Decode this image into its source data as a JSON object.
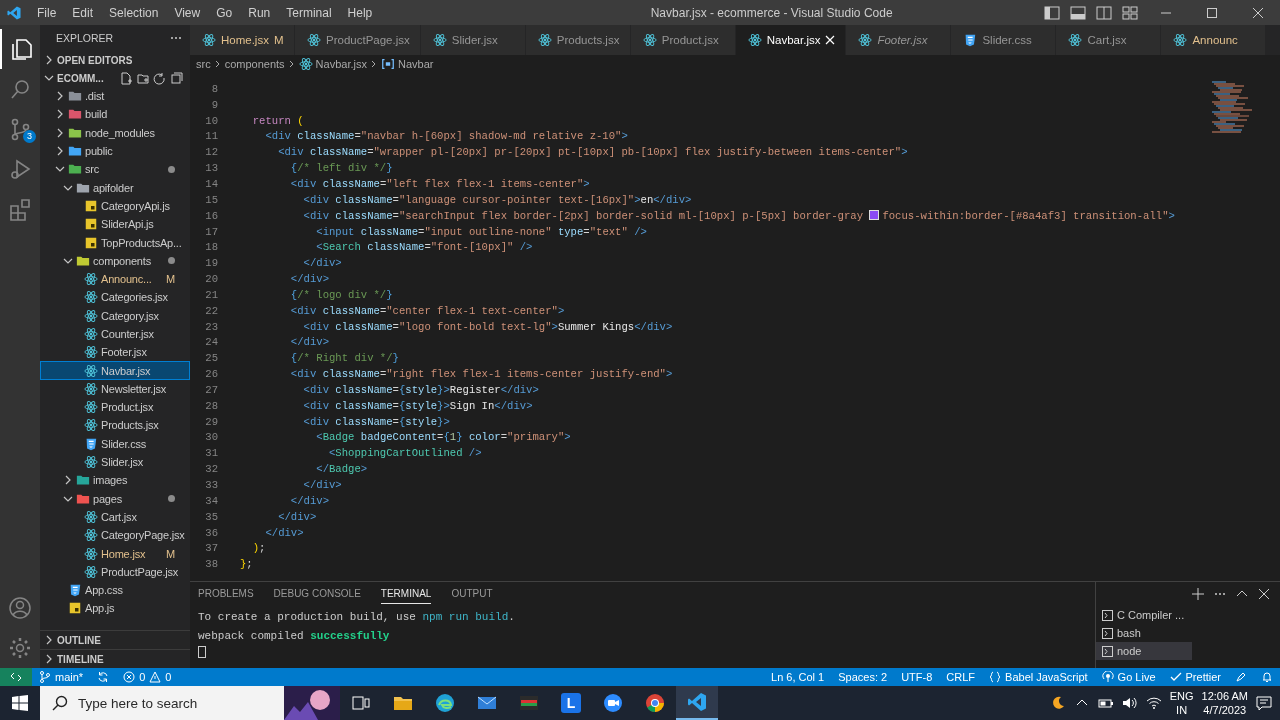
{
  "window": {
    "title": "Navbar.jsx - ecommerce - Visual Studio Code"
  },
  "menu": [
    "File",
    "Edit",
    "Selection",
    "View",
    "Go",
    "Run",
    "Terminal",
    "Help"
  ],
  "activity_bar": [
    {
      "kind": "files",
      "selected": true
    },
    {
      "kind": "search",
      "selected": false
    },
    {
      "kind": "source-control",
      "selected": false,
      "badge": "3"
    },
    {
      "kind": "run",
      "selected": false
    },
    {
      "kind": "extensions",
      "selected": false
    }
  ],
  "sidebar": {
    "title": "EXPLORER",
    "sections": [
      "OPEN EDITORS"
    ],
    "project": "ECOMM...",
    "bottom_sections": [
      "OUTLINE",
      "TIMELINE"
    ],
    "tree": [
      {
        "name": ".dist",
        "kind": "folder",
        "color": "#8a8f98",
        "expanded": false,
        "dot": false,
        "selected": false
      },
      {
        "name": "build",
        "kind": "folder",
        "color": "#d9556b",
        "expanded": false,
        "dot": false,
        "selected": false
      },
      {
        "name": "node_modules",
        "kind": "folder",
        "color": "#8bc34a",
        "expanded": false,
        "dot": false,
        "selected": false
      },
      {
        "name": "public",
        "kind": "folder",
        "color": "#42a5f5",
        "expanded": false,
        "dot": false,
        "selected": false
      },
      {
        "name": "src",
        "kind": "folder",
        "color": "#4caf50",
        "expanded": true,
        "dot": true,
        "selected": false,
        "children": [
          {
            "name": "apifolder",
            "kind": "folder",
            "color": "#9ea4ad",
            "expanded": true,
            "dot": false,
            "selected": false,
            "children": [
              {
                "name": "CategoryApi.js",
                "kind": "js",
                "selected": false
              },
              {
                "name": "SliderApi.js",
                "kind": "js",
                "selected": false
              },
              {
                "name": "TopProductsAp...",
                "kind": "js",
                "selected": false
              }
            ]
          },
          {
            "name": "components",
            "kind": "folder",
            "color": "#c0ca33",
            "expanded": true,
            "dot": true,
            "selected": false,
            "children": [
              {
                "name": "Announc...",
                "kind": "jsx",
                "selected": false,
                "badge": "M"
              },
              {
                "name": "Categories.jsx",
                "kind": "jsx",
                "selected": false
              },
              {
                "name": "Category.jsx",
                "kind": "jsx",
                "selected": false
              },
              {
                "name": "Counter.jsx",
                "kind": "jsx",
                "selected": false
              },
              {
                "name": "Footer.jsx",
                "kind": "jsx",
                "selected": false
              },
              {
                "name": "Navbar.jsx",
                "kind": "jsx",
                "selected": true
              },
              {
                "name": "Newsletter.jsx",
                "kind": "jsx",
                "selected": false
              },
              {
                "name": "Product.jsx",
                "kind": "jsx",
                "selected": false
              },
              {
                "name": "Products.jsx",
                "kind": "jsx",
                "selected": false
              },
              {
                "name": "Slider.css",
                "kind": "css",
                "selected": false
              },
              {
                "name": "Slider.jsx",
                "kind": "jsx",
                "selected": false
              }
            ]
          },
          {
            "name": "images",
            "kind": "folder",
            "color": "#26a69a",
            "expanded": false,
            "dot": false,
            "selected": false
          },
          {
            "name": "pages",
            "kind": "folder",
            "color": "#ef5350",
            "expanded": true,
            "dot": true,
            "selected": false,
            "children": [
              {
                "name": "Cart.jsx",
                "kind": "jsx",
                "selected": false
              },
              {
                "name": "CategoryPage.jsx",
                "kind": "jsx",
                "selected": false
              },
              {
                "name": "Home.jsx",
                "kind": "jsx",
                "selected": false,
                "badge": "M"
              },
              {
                "name": "ProductPage.jsx",
                "kind": "jsx",
                "selected": false
              }
            ]
          }
        ]
      },
      {
        "name": "App.css",
        "kind": "css",
        "selected": false
      },
      {
        "name": "App.js",
        "kind": "js",
        "selected": false
      }
    ]
  },
  "tabs": [
    {
      "label": "Home.jsx",
      "kind": "jsx",
      "selected": false,
      "italic": false,
      "badge": "M"
    },
    {
      "label": "ProductPage.jsx",
      "kind": "jsx",
      "selected": false,
      "italic": false
    },
    {
      "label": "Slider.jsx",
      "kind": "jsx",
      "selected": false,
      "italic": false
    },
    {
      "label": "Products.jsx",
      "kind": "jsx",
      "selected": false,
      "italic": false
    },
    {
      "label": "Product.jsx",
      "kind": "jsx",
      "selected": false,
      "italic": false
    },
    {
      "label": "Navbar.jsx",
      "kind": "jsx",
      "selected": true,
      "italic": false
    },
    {
      "label": "Footer.jsx",
      "kind": "jsx",
      "selected": false,
      "italic": true
    },
    {
      "label": "Slider.css",
      "kind": "css",
      "selected": false,
      "italic": false
    },
    {
      "label": "Cart.jsx",
      "kind": "jsx",
      "selected": false,
      "italic": false
    },
    {
      "label": "Announc",
      "kind": "jsx",
      "selected": false,
      "italic": false,
      "modified": true
    }
  ],
  "breadcrumb": [
    {
      "label": "src",
      "kind": "folder"
    },
    {
      "label": "components",
      "kind": "folder"
    },
    {
      "label": "Navbar.jsx",
      "kind": "jsx"
    },
    {
      "label": "Navbar",
      "kind": "symbol"
    }
  ],
  "code": [
    {
      "number": "8"
    },
    {
      "number": "9"
    },
    {
      "number": "10",
      "tokens": [
        {
          "kind": "kw",
          "text": "  return"
        },
        {
          "kind": "paren",
          "text": " ("
        }
      ]
    },
    {
      "number": "11",
      "tokens": [
        {
          "kind": "tag",
          "text": "    <div"
        },
        {
          "kind": "attr",
          "text": " className"
        },
        {
          "kind": "op",
          "text": "="
        },
        {
          "kind": "str",
          "text": "\"navbar h-[60px] shadow-md relative z-10\""
        },
        {
          "kind": "tag",
          "text": ">"
        }
      ]
    },
    {
      "number": "12",
      "tokens": [
        {
          "kind": "tag",
          "text": "      <div"
        },
        {
          "kind": "attr",
          "text": " className"
        },
        {
          "kind": "op",
          "text": "="
        },
        {
          "kind": "str",
          "text": "\"wrapper pl-[20px] pr-[20px] pt-[10px] pb-[10px] flex justify-between items-center\""
        },
        {
          "kind": "tag",
          "text": ">"
        }
      ]
    },
    {
      "number": "13",
      "tokens": [
        {
          "kind": "brace",
          "text": "        {"
        },
        {
          "kind": "comment",
          "text": "/* left div */"
        },
        {
          "kind": "brace",
          "text": "}"
        }
      ]
    },
    {
      "number": "14",
      "tokens": [
        {
          "kind": "tag",
          "text": "        <div"
        },
        {
          "kind": "attr",
          "text": " className"
        },
        {
          "kind": "op",
          "text": "="
        },
        {
          "kind": "str",
          "text": "\"left flex flex-1 items-center\""
        },
        {
          "kind": "tag",
          "text": ">"
        }
      ]
    },
    {
      "number": "15",
      "tokens": [
        {
          "kind": "tag",
          "text": "          <div"
        },
        {
          "kind": "attr",
          "text": " className"
        },
        {
          "kind": "op",
          "text": "="
        },
        {
          "kind": "str",
          "text": "\"language cursor-pointer text-[16px]\""
        },
        {
          "kind": "tag",
          "text": ">"
        },
        {
          "kind": "text",
          "text": "en"
        },
        {
          "kind": "tag",
          "text": "</div>"
        }
      ]
    },
    {
      "number": "16",
      "tokens": [
        {
          "kind": "tag",
          "text": "          <div"
        },
        {
          "kind": "attr",
          "text": " className"
        },
        {
          "kind": "op",
          "text": "="
        },
        {
          "kind": "str",
          "text": "\"searchInput flex border-[2px] border-solid ml-[10px] p-[5px] border-gray "
        },
        {
          "kind": "swatch",
          "color": "#8a4af3"
        },
        {
          "kind": "str",
          "text": "focus-within:border-[#8a4af3] transition-all\""
        },
        {
          "kind": "tag",
          "text": ">"
        }
      ]
    },
    {
      "number": "17",
      "tokens": [
        {
          "kind": "tag",
          "text": "            <input"
        },
        {
          "kind": "attr",
          "text": " className"
        },
        {
          "kind": "op",
          "text": "="
        },
        {
          "kind": "str",
          "text": "\"input outline-none\""
        },
        {
          "kind": "attr",
          "text": " type"
        },
        {
          "kind": "op",
          "text": "="
        },
        {
          "kind": "str",
          "text": "\"text\""
        },
        {
          "kind": "tag",
          "text": " />"
        }
      ]
    },
    {
      "number": "18",
      "tokens": [
        {
          "kind": "tag",
          "text": "            <"
        },
        {
          "kind": "comp",
          "text": "Search"
        },
        {
          "kind": "attr",
          "text": " className"
        },
        {
          "kind": "op",
          "text": "="
        },
        {
          "kind": "str",
          "text": "\"font-[10px]\""
        },
        {
          "kind": "tag",
          "text": " />"
        }
      ]
    },
    {
      "number": "19",
      "tokens": [
        {
          "kind": "tag",
          "text": "          </div>"
        }
      ]
    },
    {
      "number": "20",
      "tokens": [
        {
          "kind": "tag",
          "text": "        </div>"
        }
      ]
    },
    {
      "number": "21",
      "tokens": [
        {
          "kind": "brace",
          "text": "        {"
        },
        {
          "kind": "comment",
          "text": "/* logo div */"
        },
        {
          "kind": "brace",
          "text": "}"
        }
      ]
    },
    {
      "number": "22",
      "tokens": [
        {
          "kind": "tag",
          "text": "        <div"
        },
        {
          "kind": "attr",
          "text": " className"
        },
        {
          "kind": "op",
          "text": "="
        },
        {
          "kind": "str",
          "text": "\"center flex-1 text-center\""
        },
        {
          "kind": "tag",
          "text": ">"
        }
      ]
    },
    {
      "number": "23",
      "tokens": [
        {
          "kind": "tag",
          "text": "          <div"
        },
        {
          "kind": "attr",
          "text": " className"
        },
        {
          "kind": "op",
          "text": "="
        },
        {
          "kind": "str",
          "text": "\"logo font-bold text-lg\""
        },
        {
          "kind": "tag",
          "text": ">"
        },
        {
          "kind": "text",
          "text": "Summer Kings"
        },
        {
          "kind": "tag",
          "text": "</div>"
        }
      ]
    },
    {
      "number": "24",
      "tokens": [
        {
          "kind": "tag",
          "text": "        </div>"
        }
      ]
    },
    {
      "number": "25",
      "tokens": [
        {
          "kind": "brace",
          "text": "        {"
        },
        {
          "kind": "comment",
          "text": "/* Right div */"
        },
        {
          "kind": "brace",
          "text": "}"
        }
      ]
    },
    {
      "number": "26",
      "tokens": [
        {
          "kind": "tag",
          "text": "        <div"
        },
        {
          "kind": "attr",
          "text": " className"
        },
        {
          "kind": "op",
          "text": "="
        },
        {
          "kind": "str",
          "text": "\"right flex flex-1 items-center justify-end\""
        },
        {
          "kind": "tag",
          "text": ">"
        }
      ]
    },
    {
      "number": "27",
      "tokens": [
        {
          "kind": "tag",
          "text": "          <div"
        },
        {
          "kind": "attr",
          "text": " className"
        },
        {
          "kind": "op",
          "text": "="
        },
        {
          "kind": "brace",
          "text": "{"
        },
        {
          "kind": "var",
          "text": "style"
        },
        {
          "kind": "brace",
          "text": "}"
        },
        {
          "kind": "tag",
          "text": ">"
        },
        {
          "kind": "text",
          "text": "Register"
        },
        {
          "kind": "tag",
          "text": "</div>"
        }
      ]
    },
    {
      "number": "28",
      "tokens": [
        {
          "kind": "tag",
          "text": "          <div"
        },
        {
          "kind": "attr",
          "text": " className"
        },
        {
          "kind": "op",
          "text": "="
        },
        {
          "kind": "brace",
          "text": "{"
        },
        {
          "kind": "var",
          "text": "style"
        },
        {
          "kind": "brace",
          "text": "}"
        },
        {
          "kind": "tag",
          "text": ">"
        },
        {
          "kind": "text",
          "text": "Sign In"
        },
        {
          "kind": "tag",
          "text": "</div>"
        }
      ]
    },
    {
      "number": "29",
      "tokens": [
        {
          "kind": "tag",
          "text": "          <div"
        },
        {
          "kind": "attr",
          "text": " className"
        },
        {
          "kind": "op",
          "text": "="
        },
        {
          "kind": "brace",
          "text": "{"
        },
        {
          "kind": "var",
          "text": "style"
        },
        {
          "kind": "brace",
          "text": "}"
        },
        {
          "kind": "tag",
          "text": ">"
        }
      ]
    },
    {
      "number": "30",
      "tokens": [
        {
          "kind": "tag",
          "text": "            <"
        },
        {
          "kind": "comp",
          "text": "Badge"
        },
        {
          "kind": "attr",
          "text": " badgeContent"
        },
        {
          "kind": "op",
          "text": "="
        },
        {
          "kind": "brace",
          "text": "{"
        },
        {
          "kind": "num",
          "text": "1"
        },
        {
          "kind": "brace",
          "text": "}"
        },
        {
          "kind": "attr",
          "text": " color"
        },
        {
          "kind": "op",
          "text": "="
        },
        {
          "kind": "str",
          "text": "\"primary\""
        },
        {
          "kind": "tag",
          "text": ">"
        }
      ]
    },
    {
      "number": "31",
      "tokens": [
        {
          "kind": "tag",
          "text": "              <"
        },
        {
          "kind": "comp",
          "text": "ShoppingCartOutlined"
        },
        {
          "kind": "tag",
          "text": " />"
        }
      ]
    },
    {
      "number": "32",
      "tokens": [
        {
          "kind": "tag",
          "text": "            </"
        },
        {
          "kind": "comp",
          "text": "Badge"
        },
        {
          "kind": "tag",
          "text": ">"
        }
      ]
    },
    {
      "number": "33",
      "tokens": [
        {
          "kind": "tag",
          "text": "          </div>"
        }
      ]
    },
    {
      "number": "34",
      "tokens": [
        {
          "kind": "tag",
          "text": "        </div>"
        }
      ]
    },
    {
      "number": "35",
      "tokens": [
        {
          "kind": "tag",
          "text": "      </div>"
        }
      ]
    },
    {
      "number": "36",
      "tokens": [
        {
          "kind": "tag",
          "text": "    </div>"
        }
      ]
    },
    {
      "number": "37",
      "tokens": [
        {
          "kind": "paren",
          "text": "  )"
        },
        {
          "kind": "op",
          "text": ";"
        }
      ]
    },
    {
      "number": "38",
      "tokens": [
        {
          "kind": "paren",
          "text": "}"
        },
        {
          "kind": "op",
          "text": ";"
        }
      ]
    }
  ],
  "panel": {
    "tabs": [
      {
        "label": "PROBLEMS",
        "selected": false
      },
      {
        "label": "DEBUG CONSOLE",
        "selected": false
      },
      {
        "label": "TERMINAL",
        "selected": true
      },
      {
        "label": "OUTPUT",
        "selected": false
      }
    ],
    "lines": [
      [
        {
          "kind": "plain",
          "text": "To create a production build, use "
        },
        {
          "kind": "cmd",
          "text": "npm run build"
        },
        {
          "kind": "plain",
          "text": "."
        }
      ],
      [
        {
          "kind": "plain",
          "text": "webpack compiled "
        },
        {
          "kind": "success",
          "text": "successfully"
        }
      ]
    ],
    "terminals": [
      {
        "label": "C Compiler ...",
        "selected": false
      },
      {
        "label": "bash",
        "selected": false
      },
      {
        "label": "node",
        "selected": true
      }
    ]
  },
  "status_bar": {
    "branch": "main*",
    "errors": "0",
    "warnings": "0",
    "right": [
      {
        "kind": "plain",
        "text": "Ln 6, Col 1"
      },
      {
        "kind": "plain",
        "text": "Spaces: 2"
      },
      {
        "kind": "plain",
        "text": "UTF-8"
      },
      {
        "kind": "plain",
        "text": "CRLF"
      },
      {
        "kind": "braces",
        "text": "Babel JavaScript"
      },
      {
        "kind": "live",
        "text": "Go Live"
      },
      {
        "kind": "check",
        "text": "Prettier"
      }
    ]
  },
  "taskbar": {
    "search": {
      "placeholder": "Type here to search"
    },
    "apps": [
      {
        "kind": "task-view",
        "active": false
      },
      {
        "kind": "folder",
        "active": false
      },
      {
        "kind": "edge",
        "active": false
      },
      {
        "kind": "mail",
        "active": false
      },
      {
        "kind": "media",
        "active": false
      },
      {
        "kind": "letter",
        "label": "L",
        "active": false
      },
      {
        "kind": "camera",
        "active": false
      },
      {
        "kind": "chrome",
        "active": false
      },
      {
        "kind": "vscode",
        "active": true
      }
    ],
    "language": "ENG",
    "region": "IN",
    "time": "12:06 AM",
    "date": "4/7/2023"
  }
}
